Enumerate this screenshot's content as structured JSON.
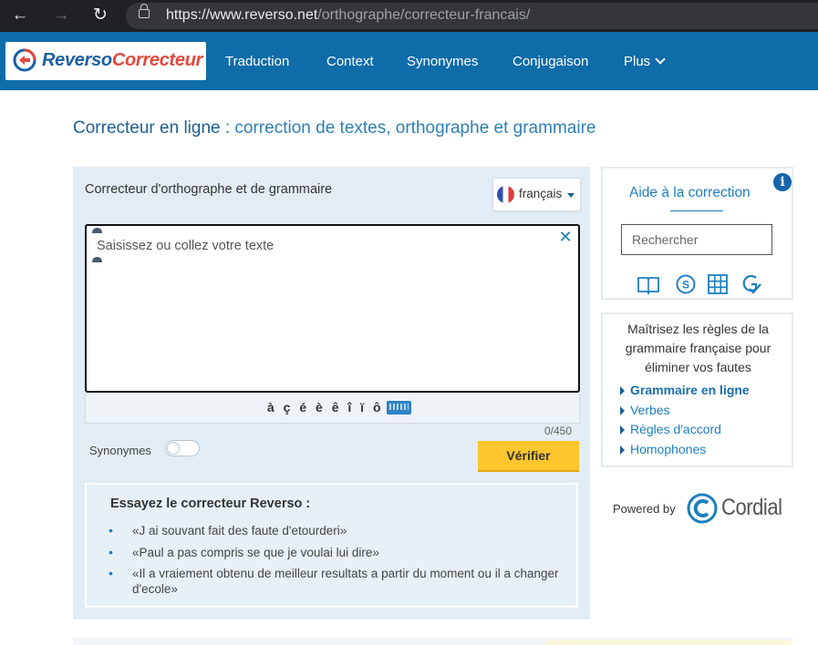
{
  "browser": {
    "url_base": "https://www.reverso.net",
    "url_path": "/orthographe/correcteur-francais/"
  },
  "header": {
    "logo_part1": "Reverso",
    "logo_part2": "Correcteur",
    "menu": [
      "Traduction",
      "Context",
      "Synonymes",
      "Conjugaison",
      "Plus"
    ]
  },
  "page": {
    "title_strong": "Correcteur en ligne",
    "title_rest": " : correction de textes, orthographe et grammaire"
  },
  "editor": {
    "heading": "Correcteur d'orthographe et de grammaire",
    "language": "français",
    "placeholder": "Saisissez ou collez votre texte",
    "accents": "à ç é è ê î ï ô ü",
    "counter": "0/450",
    "synonyms_label": "Synonymes",
    "verify_label": "Vérifier"
  },
  "examples": {
    "title": "Essayez le correcteur Reverso :",
    "items": [
      "«J ai souvant fait des faute d'etourderi»",
      "«Paul a pas compris se que je voulai lui dire»",
      "«Il a vraiement obtenu de meilleur resultats a partir du moment ou il a changer d'ecole»"
    ]
  },
  "help": {
    "title": "Aide à la correction",
    "info": "i",
    "search_placeholder": "Rechercher",
    "tools": [
      "dictionary-icon",
      "synonyms-icon",
      "conjugation-grid-icon",
      "grammar-check-icon"
    ]
  },
  "grammar": {
    "intro": "Maîtrisez les règles de la grammaire française pour éliminer vos fautes",
    "links": [
      "Grammaire en ligne",
      "Verbes",
      "Règles d'accord",
      "Homophones"
    ]
  },
  "powered": {
    "label": "Powered by",
    "brand": "Cordial"
  },
  "colors": {
    "header_blue": "#0e6ca8",
    "link_blue": "#1c7fbf",
    "verify_yellow": "#fec62e",
    "panel_bg": "#e2ecf4"
  }
}
